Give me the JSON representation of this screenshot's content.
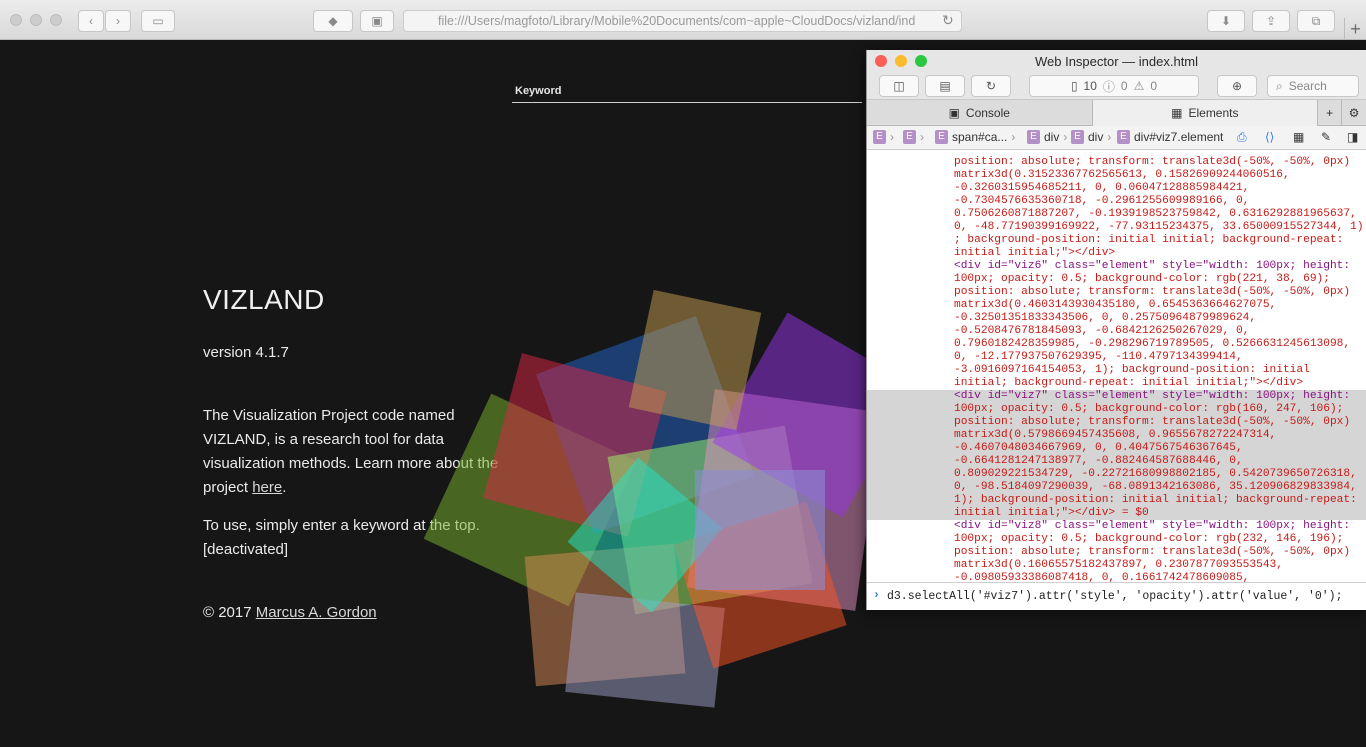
{
  "browser": {
    "url": "file:///Users/magfoto/Library/Mobile%20Documents/com~apple~CloudDocs/vizland/ind"
  },
  "page": {
    "keyword_label": "Keyword",
    "title": "VIZLAND",
    "version": "version 4.1.7",
    "description_prefix": "The Visualization Project code named VIZLAND, is a research tool for data visualization methods. Learn more about the project ",
    "description_link": "here",
    "description_suffix": ".",
    "usage_line1": "To use, simply enter a keyword at the top.",
    "usage_line2": "[deactivated]",
    "copyright_prefix": "© 2017 ",
    "copyright_link": "Marcus A. Gordon"
  },
  "inspector": {
    "window_title": "Web Inspector — index.html",
    "resources_count": "10",
    "errors_count": "0",
    "warnings_count": "0",
    "search_placeholder": "Search",
    "tabs": {
      "console": "Console",
      "elements": "Elements"
    },
    "breadcrumbs": [
      "span#ca...",
      "div",
      "div",
      "div#viz7.element"
    ],
    "console_input": "d3.selectAll('#viz7').attr('style', 'opacity').attr('value', '0');",
    "code_lines": [
      "position: absolute; transform: translate3d(-50%, -50%, 0px)",
      "matrix3d(0.31523367762565613, 0.15826909244060516,",
      "-0.3260315954685211, 0, 0.06047128885984421,",
      "-0.7304576635360718, -0.2961255609989166, 0,",
      "0.7506260871887207, -0.1939198523759842, 0.6316292881965637,",
      "0, -48.77190399169922, -77.93115234375, 33.65000915527344, 1)",
      "; background-position: initial initial; background-repeat:",
      "initial initial;\"></div>",
      "<div id=\"viz6\" class=\"element\" style=\"width: 100px; height:",
      "100px; opacity: 0.5; background-color: rgb(221, 38, 69);",
      "position: absolute; transform: translate3d(-50%, -50%, 0px)",
      "matrix3d(0.4603143930435180, 0.6545363664627075,",
      "-0.32501351833343506, 0, 0.25750964879989624,",
      "-0.5208476781845093, -0.6842126250267029, 0,",
      "0.7960182428359985, -0.298296719789505, 0.5266631245613098,",
      "0, -12.177937507629395, -110.4797134399414,",
      "-3.0916097164154053, 1); background-position: initial",
      "initial; background-repeat: initial initial;\"></div>",
      "<div id=\"viz7\" class=\"element\" style=\"width: 100px; height:",
      "100px; opacity: 0.5; background-color: rgb(160, 247, 106);",
      "position: absolute; transform: translate3d(-50%, -50%, 0px)",
      "matrix3d(0.5798669457435608, 0.9655678272247314,",
      "-0.4607048034667969, 0, 0.4047567546367645,",
      "-0.6641281247138977, -0.882464587688446, 0,",
      "0.809029221534729, -0.22721680998802185, 0.5420739650726318,",
      "0, -98.5184097290039, -68.0891342163086, 35.120906829833984,",
      "1); background-position: initial initial; background-repeat:",
      "initial initial;\"></div> = $0",
      "<div id=\"viz8\" class=\"element\" style=\"width: 100px; height:",
      "100px; opacity: 0.5; background-color: rgb(232, 146, 196);",
      "position: absolute; transform: translate3d(-50%, -50%, 0px)",
      "matrix3d(0.16065575182437897, 0.2307877093553543,",
      "-0.09805933386087418, 0, 0.1661742478609085,"
    ]
  }
}
